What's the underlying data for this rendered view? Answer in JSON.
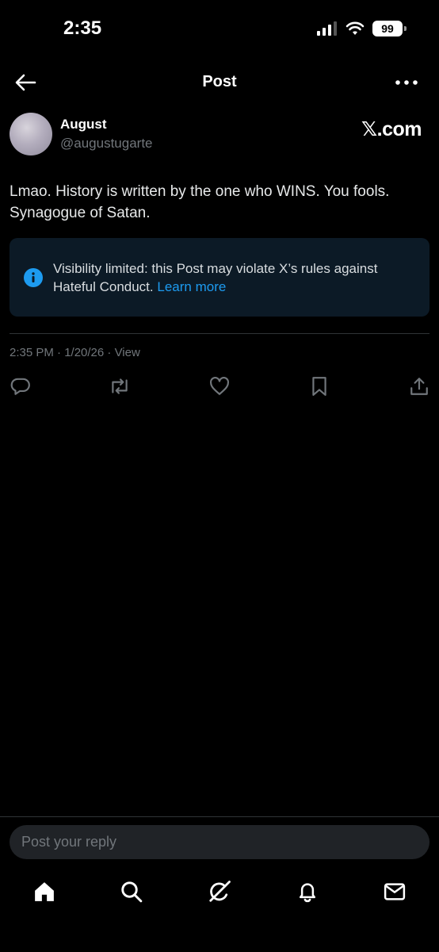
{
  "status_bar": {
    "time": "2:35",
    "battery": "99"
  },
  "header": {
    "title": "Post"
  },
  "author": {
    "name": "August",
    "handle": "@augustugarte"
  },
  "watermark": "𝕏.com",
  "post": {
    "text": "Lmao. History is written by the one who WINS. You fools. Synagogue of Satan.",
    "notice": "Visibility limited: this Post may violate X’s rules against Hateful Conduct.",
    "notice_link": "Learn more",
    "meta": "2:35 PM · 1/20/26 · View"
  },
  "actions": [
    "reply-icon",
    "repost-icon",
    "like-icon",
    "bookmark-icon",
    "share-icon"
  ],
  "reply": {
    "placeholder": "Post your reply"
  },
  "tabs": [
    "home-icon",
    "search-icon",
    "grok-icon",
    "notifications-icon",
    "messages-icon"
  ],
  "colors": {
    "background": "#000000",
    "accent": "#1d9bf0",
    "notice_bg": "#0c1a26",
    "muted": "#71767b"
  }
}
